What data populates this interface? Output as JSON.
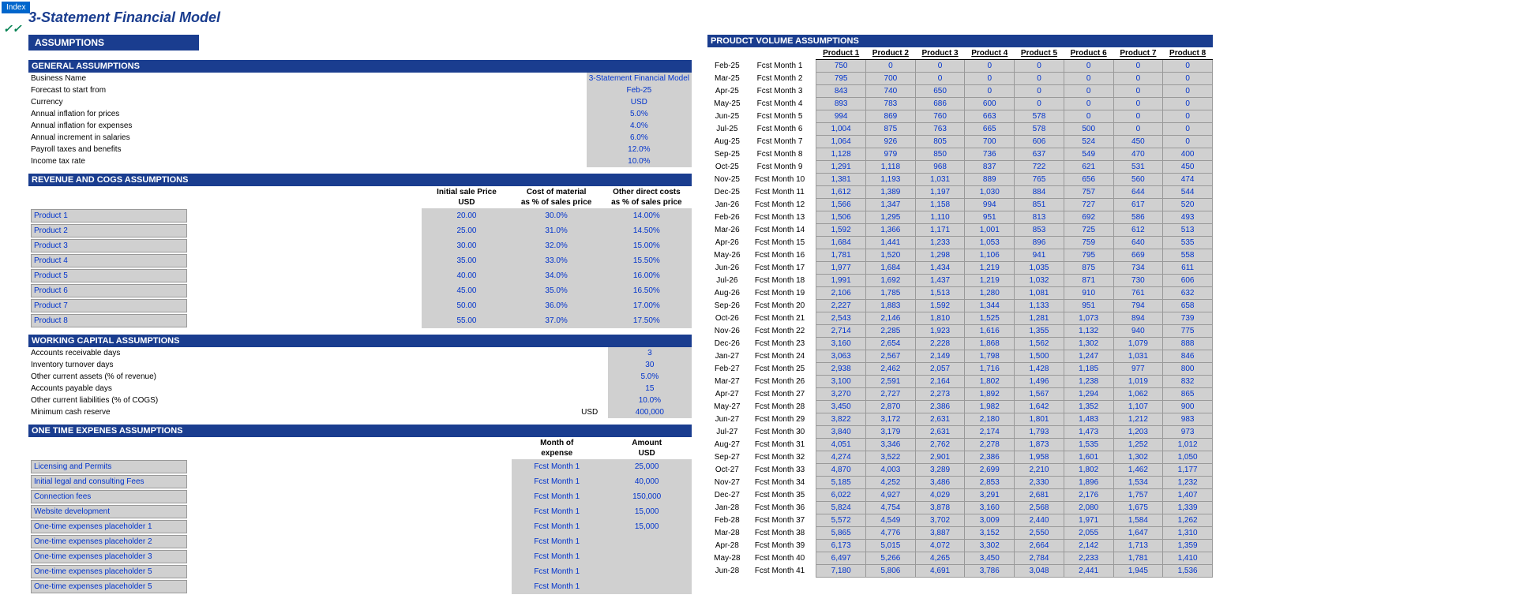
{
  "index_tab": "Index",
  "title": "3-Statement Financial Model",
  "checks": "✓✓",
  "assumptions_header": "ASSUMPTIONS",
  "general": {
    "header": "GENERAL ASSUMPTIONS",
    "rows": [
      {
        "label": "Business Name",
        "value": "3-Statement Financial Model",
        "small": true
      },
      {
        "label": "Forecast to start from",
        "value": "Feb-25"
      },
      {
        "label": "Currency",
        "value": "USD"
      },
      {
        "label": "Annual inflation for prices",
        "value": "5.0%"
      },
      {
        "label": "Annual inflation for expenses",
        "value": "4.0%"
      },
      {
        "label": "Annual increment in salaries",
        "value": "6.0%"
      },
      {
        "label": "Payroll taxes and benefits",
        "value": "12.0%"
      },
      {
        "label": "Income tax rate",
        "value": "10.0%"
      }
    ]
  },
  "revenue": {
    "header": "REVENUE AND COGS ASSUMPTIONS",
    "col1": "Initial sale Price",
    "col1b": "USD",
    "col2": "Cost of material",
    "col2b": "as % of sales price",
    "col3": "Other direct costs",
    "col3b": "as % of sales price",
    "rows": [
      {
        "p": "Product 1",
        "price": "20.00",
        "mat": "30.0%",
        "odc": "14.00%"
      },
      {
        "p": "Product 2",
        "price": "25.00",
        "mat": "31.0%",
        "odc": "14.50%"
      },
      {
        "p": "Product 3",
        "price": "30.00",
        "mat": "32.0%",
        "odc": "15.00%"
      },
      {
        "p": "Product 4",
        "price": "35.00",
        "mat": "33.0%",
        "odc": "15.50%"
      },
      {
        "p": "Product 5",
        "price": "40.00",
        "mat": "34.0%",
        "odc": "16.00%"
      },
      {
        "p": "Product 6",
        "price": "45.00",
        "mat": "35.0%",
        "odc": "16.50%"
      },
      {
        "p": "Product 7",
        "price": "50.00",
        "mat": "36.0%",
        "odc": "17.00%"
      },
      {
        "p": "Product 8",
        "price": "55.00",
        "mat": "37.0%",
        "odc": "17.50%"
      }
    ]
  },
  "wc": {
    "header": "WORKING CAPITAL ASSUMPTIONS",
    "rows": [
      {
        "label": "Accounts receivable days",
        "unit": "",
        "value": "3"
      },
      {
        "label": "Inventory turnover days",
        "unit": "",
        "value": "30"
      },
      {
        "label": "Other current assets (% of revenue)",
        "unit": "",
        "value": "5.0%"
      },
      {
        "label": "Accounts payable days",
        "unit": "",
        "value": "15"
      },
      {
        "label": "Other current liabilities (% of COGS)",
        "unit": "",
        "value": "10.0%"
      },
      {
        "label": "Minimum cash reserve",
        "unit": "USD",
        "value": "400,000"
      }
    ]
  },
  "onetime": {
    "header": "ONE TIME EXPENES ASSUMPTIONS",
    "col1a": "Month of",
    "col1b": "expense",
    "col2a": "Amount",
    "col2b": "USD",
    "rows": [
      {
        "label": "Licensing and Permits",
        "m": "Fcst Month 1",
        "amt": "25,000"
      },
      {
        "label": "Initial legal and consulting Fees",
        "m": "Fcst Month 1",
        "amt": "40,000"
      },
      {
        "label": "Connection fees",
        "m": "Fcst Month 1",
        "amt": "150,000"
      },
      {
        "label": "Website development",
        "m": "Fcst Month 1",
        "amt": "15,000"
      },
      {
        "label": "One-time expenses placeholder 1",
        "m": "Fcst Month 1",
        "amt": "15,000"
      },
      {
        "label": "One-time expenses placeholder 2",
        "m": "Fcst Month 1",
        "amt": ""
      },
      {
        "label": "One-time expenses placeholder 3",
        "m": "Fcst Month 1",
        "amt": ""
      },
      {
        "label": "One-time expenses placeholder 5",
        "m": "Fcst Month 1",
        "amt": ""
      },
      {
        "label": "One-time expenses placeholder 5",
        "m": "Fcst Month 1",
        "amt": ""
      }
    ]
  },
  "volume": {
    "header": "PROUDCT VOLUME ASSUMPTIONS",
    "products": [
      "Product 1",
      "Product 2",
      "Product 3",
      "Product 4",
      "Product 5",
      "Product 6",
      "Product 7",
      "Product 8"
    ],
    "rows": [
      {
        "m": "Feb-25",
        "f": "Fcst Month 1",
        "v": [
          "750",
          "0",
          "0",
          "0",
          "0",
          "0",
          "0",
          "0"
        ]
      },
      {
        "m": "Mar-25",
        "f": "Fcst Month 2",
        "v": [
          "795",
          "700",
          "0",
          "0",
          "0",
          "0",
          "0",
          "0"
        ]
      },
      {
        "m": "Apr-25",
        "f": "Fcst Month 3",
        "v": [
          "843",
          "740",
          "650",
          "0",
          "0",
          "0",
          "0",
          "0"
        ]
      },
      {
        "m": "May-25",
        "f": "Fcst Month 4",
        "v": [
          "893",
          "783",
          "686",
          "600",
          "0",
          "0",
          "0",
          "0"
        ]
      },
      {
        "m": "Jun-25",
        "f": "Fcst Month 5",
        "v": [
          "994",
          "869",
          "760",
          "663",
          "578",
          "0",
          "0",
          "0"
        ]
      },
      {
        "m": "Jul-25",
        "f": "Fcst Month 6",
        "v": [
          "1,004",
          "875",
          "763",
          "665",
          "578",
          "500",
          "0",
          "0"
        ]
      },
      {
        "m": "Aug-25",
        "f": "Fcst Month 7",
        "v": [
          "1,064",
          "926",
          "805",
          "700",
          "606",
          "524",
          "450",
          "0"
        ]
      },
      {
        "m": "Sep-25",
        "f": "Fcst Month 8",
        "v": [
          "1,128",
          "979",
          "850",
          "736",
          "637",
          "549",
          "470",
          "400"
        ]
      },
      {
        "m": "Oct-25",
        "f": "Fcst Month 9",
        "v": [
          "1,291",
          "1,118",
          "968",
          "837",
          "722",
          "621",
          "531",
          "450"
        ]
      },
      {
        "m": "Nov-25",
        "f": "Fcst Month 10",
        "v": [
          "1,381",
          "1,193",
          "1,031",
          "889",
          "765",
          "656",
          "560",
          "474"
        ]
      },
      {
        "m": "Dec-25",
        "f": "Fcst Month 11",
        "v": [
          "1,612",
          "1,389",
          "1,197",
          "1,030",
          "884",
          "757",
          "644",
          "544"
        ]
      },
      {
        "m": "Jan-26",
        "f": "Fcst Month 12",
        "v": [
          "1,566",
          "1,347",
          "1,158",
          "994",
          "851",
          "727",
          "617",
          "520"
        ]
      },
      {
        "m": "Feb-26",
        "f": "Fcst Month 13",
        "v": [
          "1,506",
          "1,295",
          "1,110",
          "951",
          "813",
          "692",
          "586",
          "493"
        ]
      },
      {
        "m": "Mar-26",
        "f": "Fcst Month 14",
        "v": [
          "1,592",
          "1,366",
          "1,171",
          "1,001",
          "853",
          "725",
          "612",
          "513"
        ]
      },
      {
        "m": "Apr-26",
        "f": "Fcst Month 15",
        "v": [
          "1,684",
          "1,441",
          "1,233",
          "1,053",
          "896",
          "759",
          "640",
          "535"
        ]
      },
      {
        "m": "May-26",
        "f": "Fcst Month 16",
        "v": [
          "1,781",
          "1,520",
          "1,298",
          "1,106",
          "941",
          "795",
          "669",
          "558"
        ]
      },
      {
        "m": "Jun-26",
        "f": "Fcst Month 17",
        "v": [
          "1,977",
          "1,684",
          "1,434",
          "1,219",
          "1,035",
          "875",
          "734",
          "611"
        ]
      },
      {
        "m": "Jul-26",
        "f": "Fcst Month 18",
        "v": [
          "1,991",
          "1,692",
          "1,437",
          "1,219",
          "1,032",
          "871",
          "730",
          "606"
        ]
      },
      {
        "m": "Aug-26",
        "f": "Fcst Month 19",
        "v": [
          "2,106",
          "1,785",
          "1,513",
          "1,280",
          "1,081",
          "910",
          "761",
          "632"
        ]
      },
      {
        "m": "Sep-26",
        "f": "Fcst Month 20",
        "v": [
          "2,227",
          "1,883",
          "1,592",
          "1,344",
          "1,133",
          "951",
          "794",
          "658"
        ]
      },
      {
        "m": "Oct-26",
        "f": "Fcst Month 21",
        "v": [
          "2,543",
          "2,146",
          "1,810",
          "1,525",
          "1,281",
          "1,073",
          "894",
          "739"
        ]
      },
      {
        "m": "Nov-26",
        "f": "Fcst Month 22",
        "v": [
          "2,714",
          "2,285",
          "1,923",
          "1,616",
          "1,355",
          "1,132",
          "940",
          "775"
        ]
      },
      {
        "m": "Dec-26",
        "f": "Fcst Month 23",
        "v": [
          "3,160",
          "2,654",
          "2,228",
          "1,868",
          "1,562",
          "1,302",
          "1,079",
          "888"
        ]
      },
      {
        "m": "Jan-27",
        "f": "Fcst Month 24",
        "v": [
          "3,063",
          "2,567",
          "2,149",
          "1,798",
          "1,500",
          "1,247",
          "1,031",
          "846"
        ]
      },
      {
        "m": "Feb-27",
        "f": "Fcst Month 25",
        "v": [
          "2,938",
          "2,462",
          "2,057",
          "1,716",
          "1,428",
          "1,185",
          "977",
          "800"
        ]
      },
      {
        "m": "Mar-27",
        "f": "Fcst Month 26",
        "v": [
          "3,100",
          "2,591",
          "2,164",
          "1,802",
          "1,496",
          "1,238",
          "1,019",
          "832"
        ]
      },
      {
        "m": "Apr-27",
        "f": "Fcst Month 27",
        "v": [
          "3,270",
          "2,727",
          "2,273",
          "1,892",
          "1,567",
          "1,294",
          "1,062",
          "865"
        ]
      },
      {
        "m": "May-27",
        "f": "Fcst Month 28",
        "v": [
          "3,450",
          "2,870",
          "2,386",
          "1,982",
          "1,642",
          "1,352",
          "1,107",
          "900"
        ]
      },
      {
        "m": "Jun-27",
        "f": "Fcst Month 29",
        "v": [
          "3,822",
          "3,172",
          "2,631",
          "2,180",
          "1,801",
          "1,483",
          "1,212",
          "983"
        ]
      },
      {
        "m": "Jul-27",
        "f": "Fcst Month 30",
        "v": [
          "3,840",
          "3,179",
          "2,631",
          "2,174",
          "1,793",
          "1,473",
          "1,203",
          "973"
        ]
      },
      {
        "m": "Aug-27",
        "f": "Fcst Month 31",
        "v": [
          "4,051",
          "3,346",
          "2,762",
          "2,278",
          "1,873",
          "1,535",
          "1,252",
          "1,012"
        ]
      },
      {
        "m": "Sep-27",
        "f": "Fcst Month 32",
        "v": [
          "4,274",
          "3,522",
          "2,901",
          "2,386",
          "1,958",
          "1,601",
          "1,302",
          "1,050"
        ]
      },
      {
        "m": "Oct-27",
        "f": "Fcst Month 33",
        "v": [
          "4,870",
          "4,003",
          "3,289",
          "2,699",
          "2,210",
          "1,802",
          "1,462",
          "1,177"
        ]
      },
      {
        "m": "Nov-27",
        "f": "Fcst Month 34",
        "v": [
          "5,185",
          "4,252",
          "3,486",
          "2,853",
          "2,330",
          "1,896",
          "1,534",
          "1,232"
        ]
      },
      {
        "m": "Dec-27",
        "f": "Fcst Month 35",
        "v": [
          "6,022",
          "4,927",
          "4,029",
          "3,291",
          "2,681",
          "2,176",
          "1,757",
          "1,407"
        ]
      },
      {
        "m": "Jan-28",
        "f": "Fcst Month 36",
        "v": [
          "5,824",
          "4,754",
          "3,878",
          "3,160",
          "2,568",
          "2,080",
          "1,675",
          "1,339"
        ]
      },
      {
        "m": "Feb-28",
        "f": "Fcst Month 37",
        "v": [
          "5,572",
          "4,549",
          "3,702",
          "3,009",
          "2,440",
          "1,971",
          "1,584",
          "1,262"
        ]
      },
      {
        "m": "Mar-28",
        "f": "Fcst Month 38",
        "v": [
          "5,865",
          "4,776",
          "3,887",
          "3,152",
          "2,550",
          "2,055",
          "1,647",
          "1,310"
        ]
      },
      {
        "m": "Apr-28",
        "f": "Fcst Month 39",
        "v": [
          "6,173",
          "5,015",
          "4,072",
          "3,302",
          "2,664",
          "2,142",
          "1,713",
          "1,359"
        ]
      },
      {
        "m": "May-28",
        "f": "Fcst Month 40",
        "v": [
          "6,497",
          "5,266",
          "4,265",
          "3,450",
          "2,784",
          "2,233",
          "1,781",
          "1,410"
        ]
      },
      {
        "m": "Jun-28",
        "f": "Fcst Month 41",
        "v": [
          "7,180",
          "5,806",
          "4,691",
          "3,786",
          "3,048",
          "2,441",
          "1,945",
          "1,536"
        ]
      }
    ]
  }
}
